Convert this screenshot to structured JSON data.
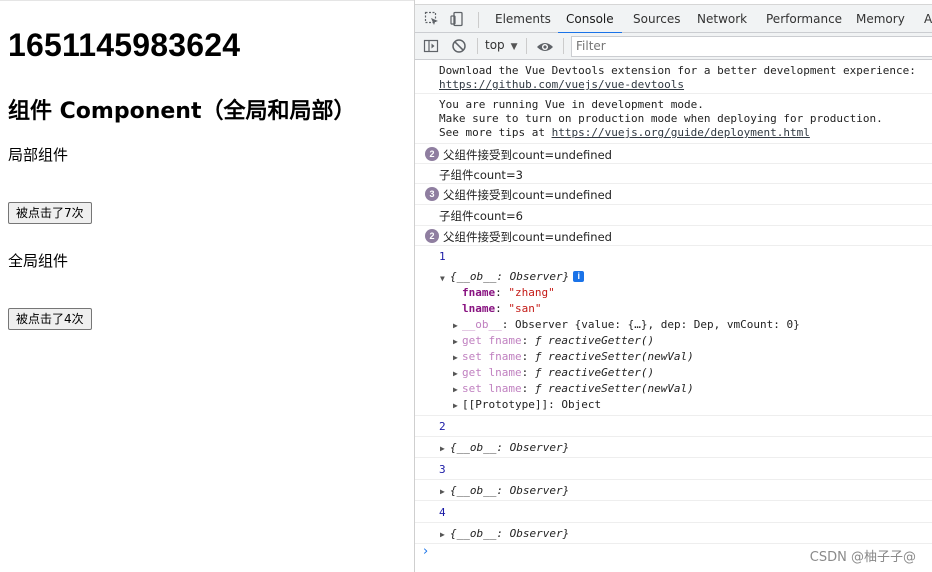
{
  "page": {
    "timestamp": "1651145983624",
    "heading": "组件 Component（全局和局部）",
    "local_label": "局部组件",
    "local_button": "被点击了7次",
    "global_label": "全局组件",
    "global_button": "被点击了4次"
  },
  "devtools": {
    "tabs": [
      "Elements",
      "Console",
      "Sources",
      "Network",
      "Performance",
      "Memory",
      "A"
    ],
    "active_tab": "Console",
    "toolbar": {
      "context": "top",
      "filter_placeholder": "Filter"
    },
    "console": {
      "devtools_msg": "Download the Vue Devtools extension for a better development experience:",
      "devtools_link": "https://github.com/vuejs/vue-devtools",
      "dev_mode_1": "You are running Vue in development mode.",
      "dev_mode_2": "Make sure to turn on production mode when deploying for production.",
      "dev_mode_3_prefix": "See more tips at ",
      "dev_mode_link": "https://vuejs.org/guide/deployment.html",
      "log1_count": "2",
      "log1_text": "父组件接受到count=undefined",
      "log2_text": "子组件count=3",
      "log3_count": "3",
      "log3_text": "父组件接受到count=undefined",
      "log4_text": "子组件count=6",
      "log5_count": "2",
      "log5_text": "父组件接受到count=undefined",
      "n1": "1",
      "obj_summary": "{__ob__: Observer}",
      "obj_info": "i",
      "fname_key": "fname",
      "fname_val": "\"zhang\"",
      "lname_key": "lname",
      "lname_val": "\"san\"",
      "ob_key": "__ob__",
      "ob_val": "Observer {value: {…}, dep: Dep, vmCount: 0}",
      "get_fname": "get fname",
      "set_fname": "set fname",
      "get_lname": "get lname",
      "set_lname": "set lname",
      "getter": "ƒ reactiveGetter()",
      "setter": "ƒ reactiveSetter(newVal)",
      "proto": "[[Prototype]]: Object",
      "n2": "2",
      "n3": "3",
      "n4": "4",
      "prompt": "›"
    }
  },
  "watermark": "CSDN @柚子子@",
  "colors": {
    "accent": "#1a73e8",
    "badge": "#8f7ea0",
    "string": "#c41a16",
    "key": "#881280",
    "number": "#1a1aa6"
  }
}
